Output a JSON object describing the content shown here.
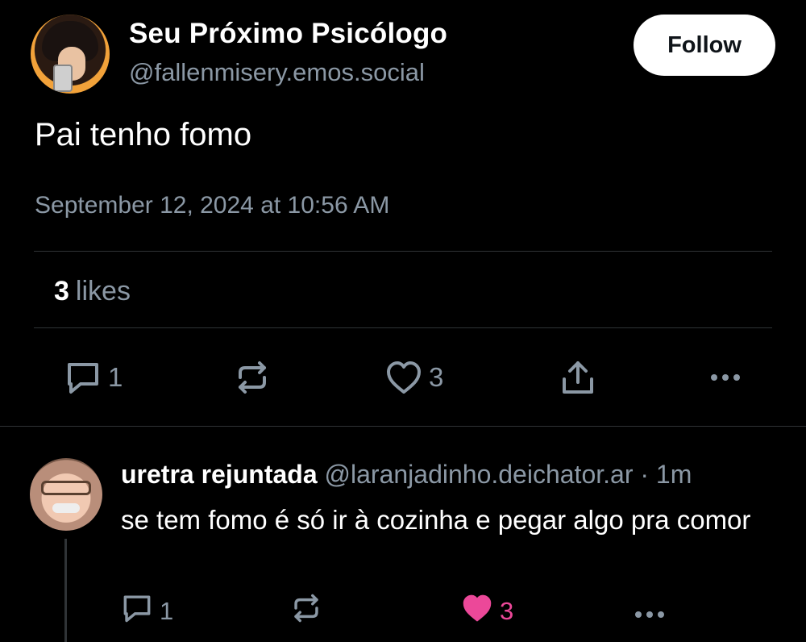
{
  "post": {
    "author_name": "Seu Próximo Psicólogo",
    "author_handle": "@fallenmisery.emos.social",
    "follow_label": "Follow",
    "text": "Pai tenho fomo",
    "timestamp": "September 12, 2024 at 10:56 AM",
    "likes_count": "3",
    "likes_label": "likes",
    "actions": {
      "reply_count": "1",
      "repost_count": "",
      "like_count": "3"
    }
  },
  "reply": {
    "author_name": "uretra rejuntada",
    "author_handle": "@laranjadinho.deichator.ar",
    "separator": " · ",
    "age": "1m",
    "text": "se tem fomo é só ir à cozinha e pegar algo pra comor",
    "actions": {
      "reply_count": "1",
      "like_count": "3"
    }
  },
  "colors": {
    "background": "#000000",
    "muted": "#8b98a5",
    "liked": "#ec4899",
    "divider": "#2f3336"
  },
  "icons": [
    "reply-icon",
    "repost-icon",
    "like-icon",
    "share-icon",
    "more-icon",
    "liked-heart-icon"
  ]
}
